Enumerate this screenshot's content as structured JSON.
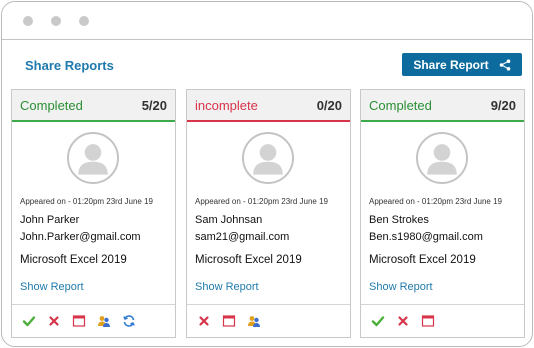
{
  "header": {
    "title": "Share Reports",
    "share_button": "Share Report"
  },
  "cards": [
    {
      "status": "Completed",
      "score": "5/20",
      "appeared": "Appeared on - 01:20pm 23rd June 19",
      "name": "John Parker",
      "email": "John.Parker@gmail.com",
      "course": "Microsoft Excel 2019",
      "link": "Show Report"
    },
    {
      "status": "incomplete",
      "score": "0/20",
      "appeared": "Appeared on - 01:20pm 23rd June 19",
      "name": "Sam Johnsan",
      "email": "sam21@gmail.com",
      "course": "Microsoft Excel 2019",
      "link": "Show Report"
    },
    {
      "status": "Completed",
      "score": "9/20",
      "appeared": "Appeared on - 01:20pm 23rd June 19",
      "name": "Ben Strokes",
      "email": "Ben.s1980@gmail.com",
      "course": "Microsoft Excel 2019",
      "link": "Show Report"
    }
  ],
  "colors": {
    "accent": "#0d6b9e",
    "complete": "#2a8f35",
    "incomplete": "#d8344a"
  }
}
